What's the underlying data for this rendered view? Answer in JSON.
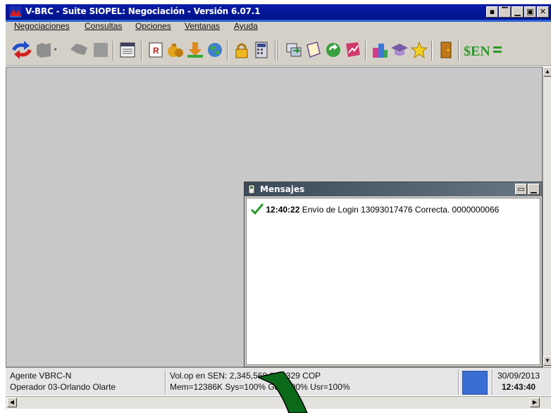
{
  "window": {
    "title": "V-BRC - Suite SIOPEL: Negociación - Versión 6.07.1",
    "buttons": [
      "▪",
      "▔",
      "▁",
      "▣",
      "✕"
    ]
  },
  "menu": {
    "items": [
      "Negociaciones",
      "Consultas",
      "Opciones",
      "Ventanas",
      "Ayuda"
    ]
  },
  "toolbar": {
    "icons": [
      "refresh-arrows-icon",
      "folder-icon",
      "back-icon",
      "window-icon",
      "table-icon",
      "report-r-icon",
      "money-bag-icon",
      "download-arrow-icon",
      "globe-icon",
      "lock-icon",
      "calculator-icon",
      "transfer-icon",
      "document-icon",
      "sync-icon",
      "chart-icon",
      "buildings-icon",
      "graduation-cap-icon",
      "star-icon",
      "door-icon",
      "sen-icon"
    ],
    "sen_label": "$EN"
  },
  "messages_window": {
    "title": "Mensajes",
    "entries": [
      {
        "time": "12:40:22",
        "text": "Envío de Login 13093017476 Correcta. 0000000066"
      }
    ]
  },
  "status": {
    "agent": "Agente VBRC-N",
    "operator": "Operador 03-Orlando Olarte",
    "volume": "Vol.op en SEN:  2,345,568,226,329 COP",
    "memory": "Mem=12386K Sys=100% Gdi=100% Usr=100%",
    "date": "30/09/2013",
    "time": "12:43:40",
    "indicator_color": "#3a6dd2"
  }
}
